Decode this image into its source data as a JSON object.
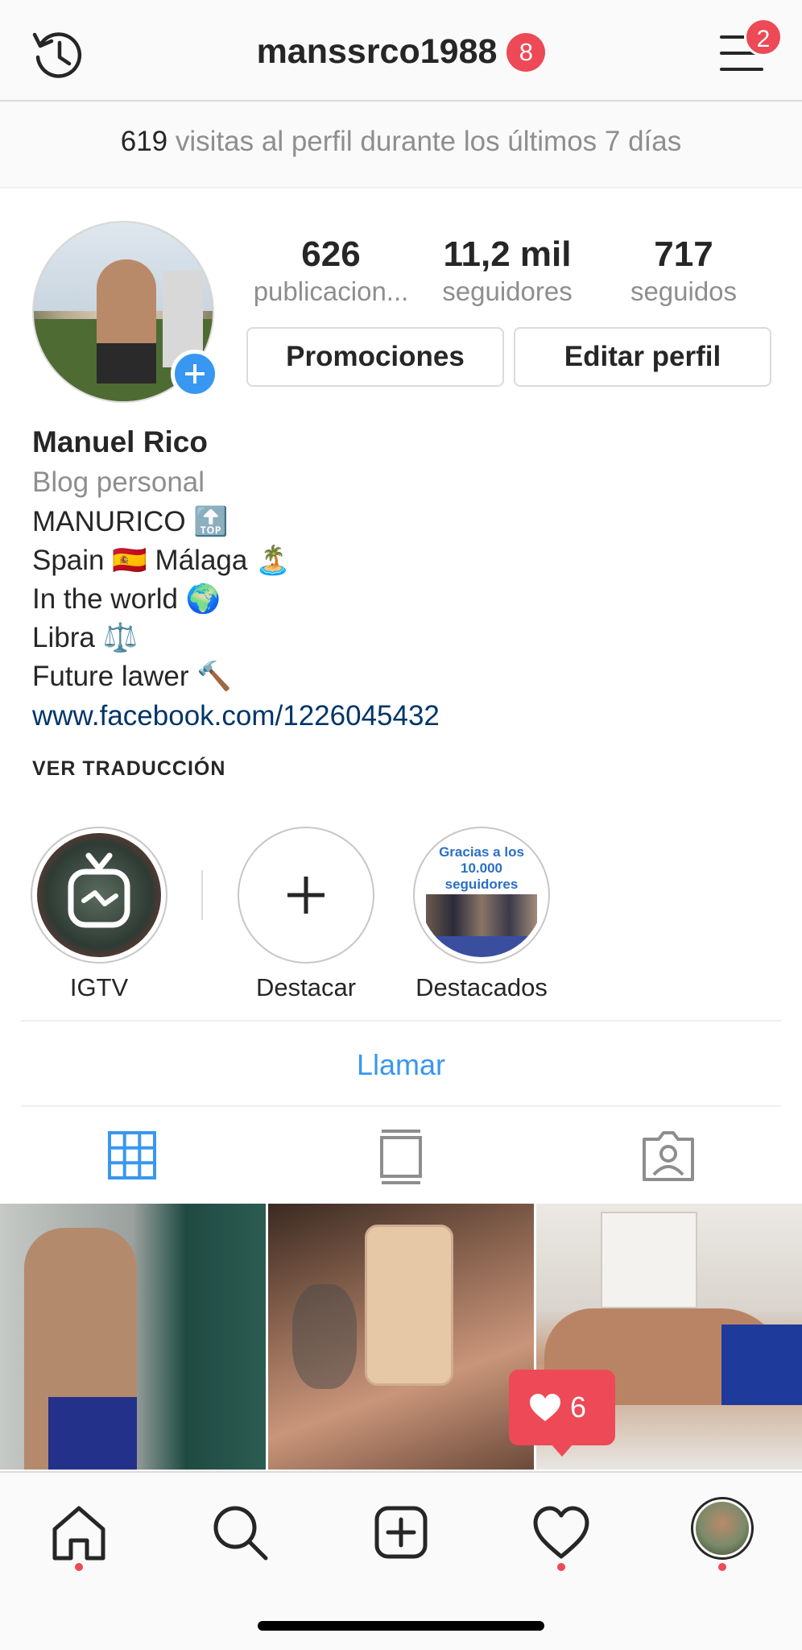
{
  "header": {
    "username": "manssrco1988",
    "username_badge": "8",
    "menu_badge": "2"
  },
  "insights": {
    "visits_count": "619",
    "visits_text": "visitas al perfil durante los últimos 7 días"
  },
  "profile": {
    "stats": [
      {
        "value": "626",
        "label": "publicacion..."
      },
      {
        "value": "11,2 mil",
        "label": "seguidores"
      },
      {
        "value": "717",
        "label": "seguidos"
      }
    ],
    "buttons": {
      "promotions": "Promociones",
      "edit_profile": "Editar perfil"
    },
    "name": "Manuel Rico",
    "category": "Blog personal",
    "bio_lines": [
      "MANURICO 🔝",
      "Spain 🇪🇸 Málaga 🏝️",
      "In the world 🌍",
      "Libra ⚖️",
      "Future lawer 🔨"
    ],
    "link": "www.facebook.com/1226045432",
    "translate": "VER TRADUCCIÓN"
  },
  "highlights": [
    {
      "label": "IGTV"
    },
    {
      "label": "Destacar"
    },
    {
      "label": "Destacados",
      "cover_text": "Gracias a los 10.000 seguidores"
    }
  ],
  "contact": {
    "call": "Llamar"
  },
  "tabs": [
    "grid",
    "feed",
    "tagged"
  ],
  "like_notification": {
    "count": "6"
  },
  "colors": {
    "accent": "#3897f0",
    "badge": "#ed4956",
    "link": "#003569",
    "muted": "#8e8e8e"
  },
  "bottom_nav": [
    "home-icon",
    "search-icon",
    "new-post-icon",
    "activity-heart-icon",
    "profile-avatar"
  ]
}
